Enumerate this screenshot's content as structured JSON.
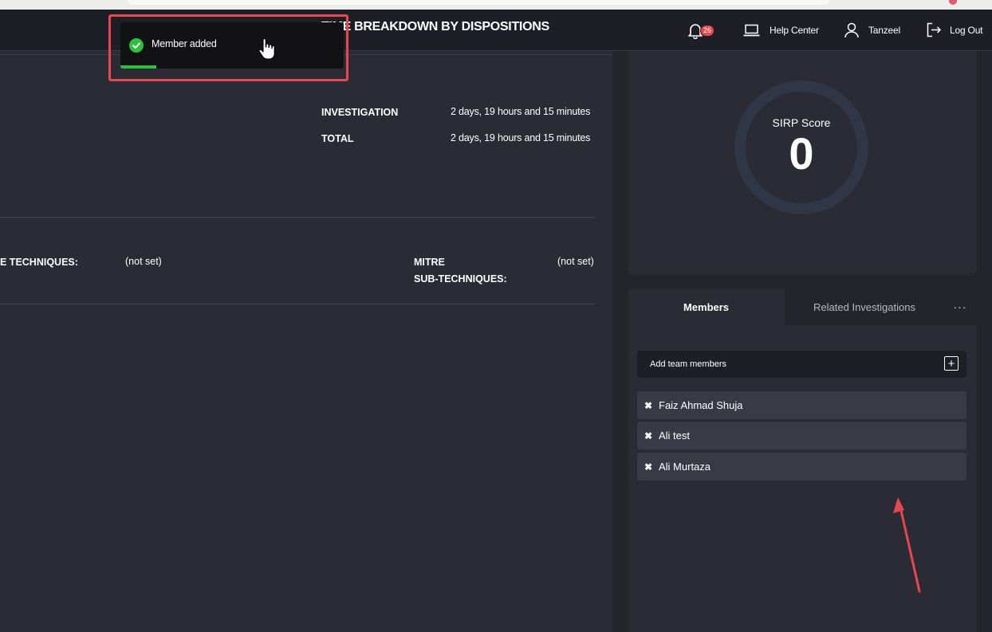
{
  "header": {
    "notification_count": "26",
    "help_label": "Help Center",
    "user_label": "Tanzeel",
    "logout_label": "Log Out"
  },
  "toast": {
    "message": "Member added",
    "progress_percent": 16
  },
  "time_breakdown": {
    "title": "TIME BREAKDOWN BY DISPOSITIONS",
    "rows": [
      {
        "label": "INVESTIGATION",
        "value": "2 days, 19 hours and 15 minutes"
      },
      {
        "label": "TOTAL",
        "value": "2 days, 19 hours and 15 minutes"
      }
    ]
  },
  "mitre": {
    "techniques_label": "E TECHNIQUES:",
    "techniques_value": "(not set)",
    "subtechniques_label_line1": "MITRE",
    "subtechniques_label_line2": "SUB-TECHNIQUES:",
    "subtechniques_value": "(not set)"
  },
  "score": {
    "label": "SIRP Score",
    "value": "0"
  },
  "members_panel": {
    "tabs": [
      {
        "label": "Members",
        "active": true
      },
      {
        "label": "Related Investigations",
        "active": false
      }
    ],
    "more_label": "···",
    "add_label": "Add team members",
    "add_button_label": "+",
    "remove_glyph": "✖",
    "members": [
      {
        "name": "Faiz Ahmad Shuja"
      },
      {
        "name": "Ali test"
      },
      {
        "name": "Ali Murtaza"
      }
    ]
  },
  "colors": {
    "accent_red": "#e5484d",
    "success_green": "#2fbf3f",
    "ring": "#2f3646"
  },
  "icons": [
    "bell-icon",
    "laptop-icon",
    "user-icon",
    "logout-icon",
    "check-circle-icon",
    "hand-cursor-icon",
    "plus-icon",
    "close-icon"
  ]
}
